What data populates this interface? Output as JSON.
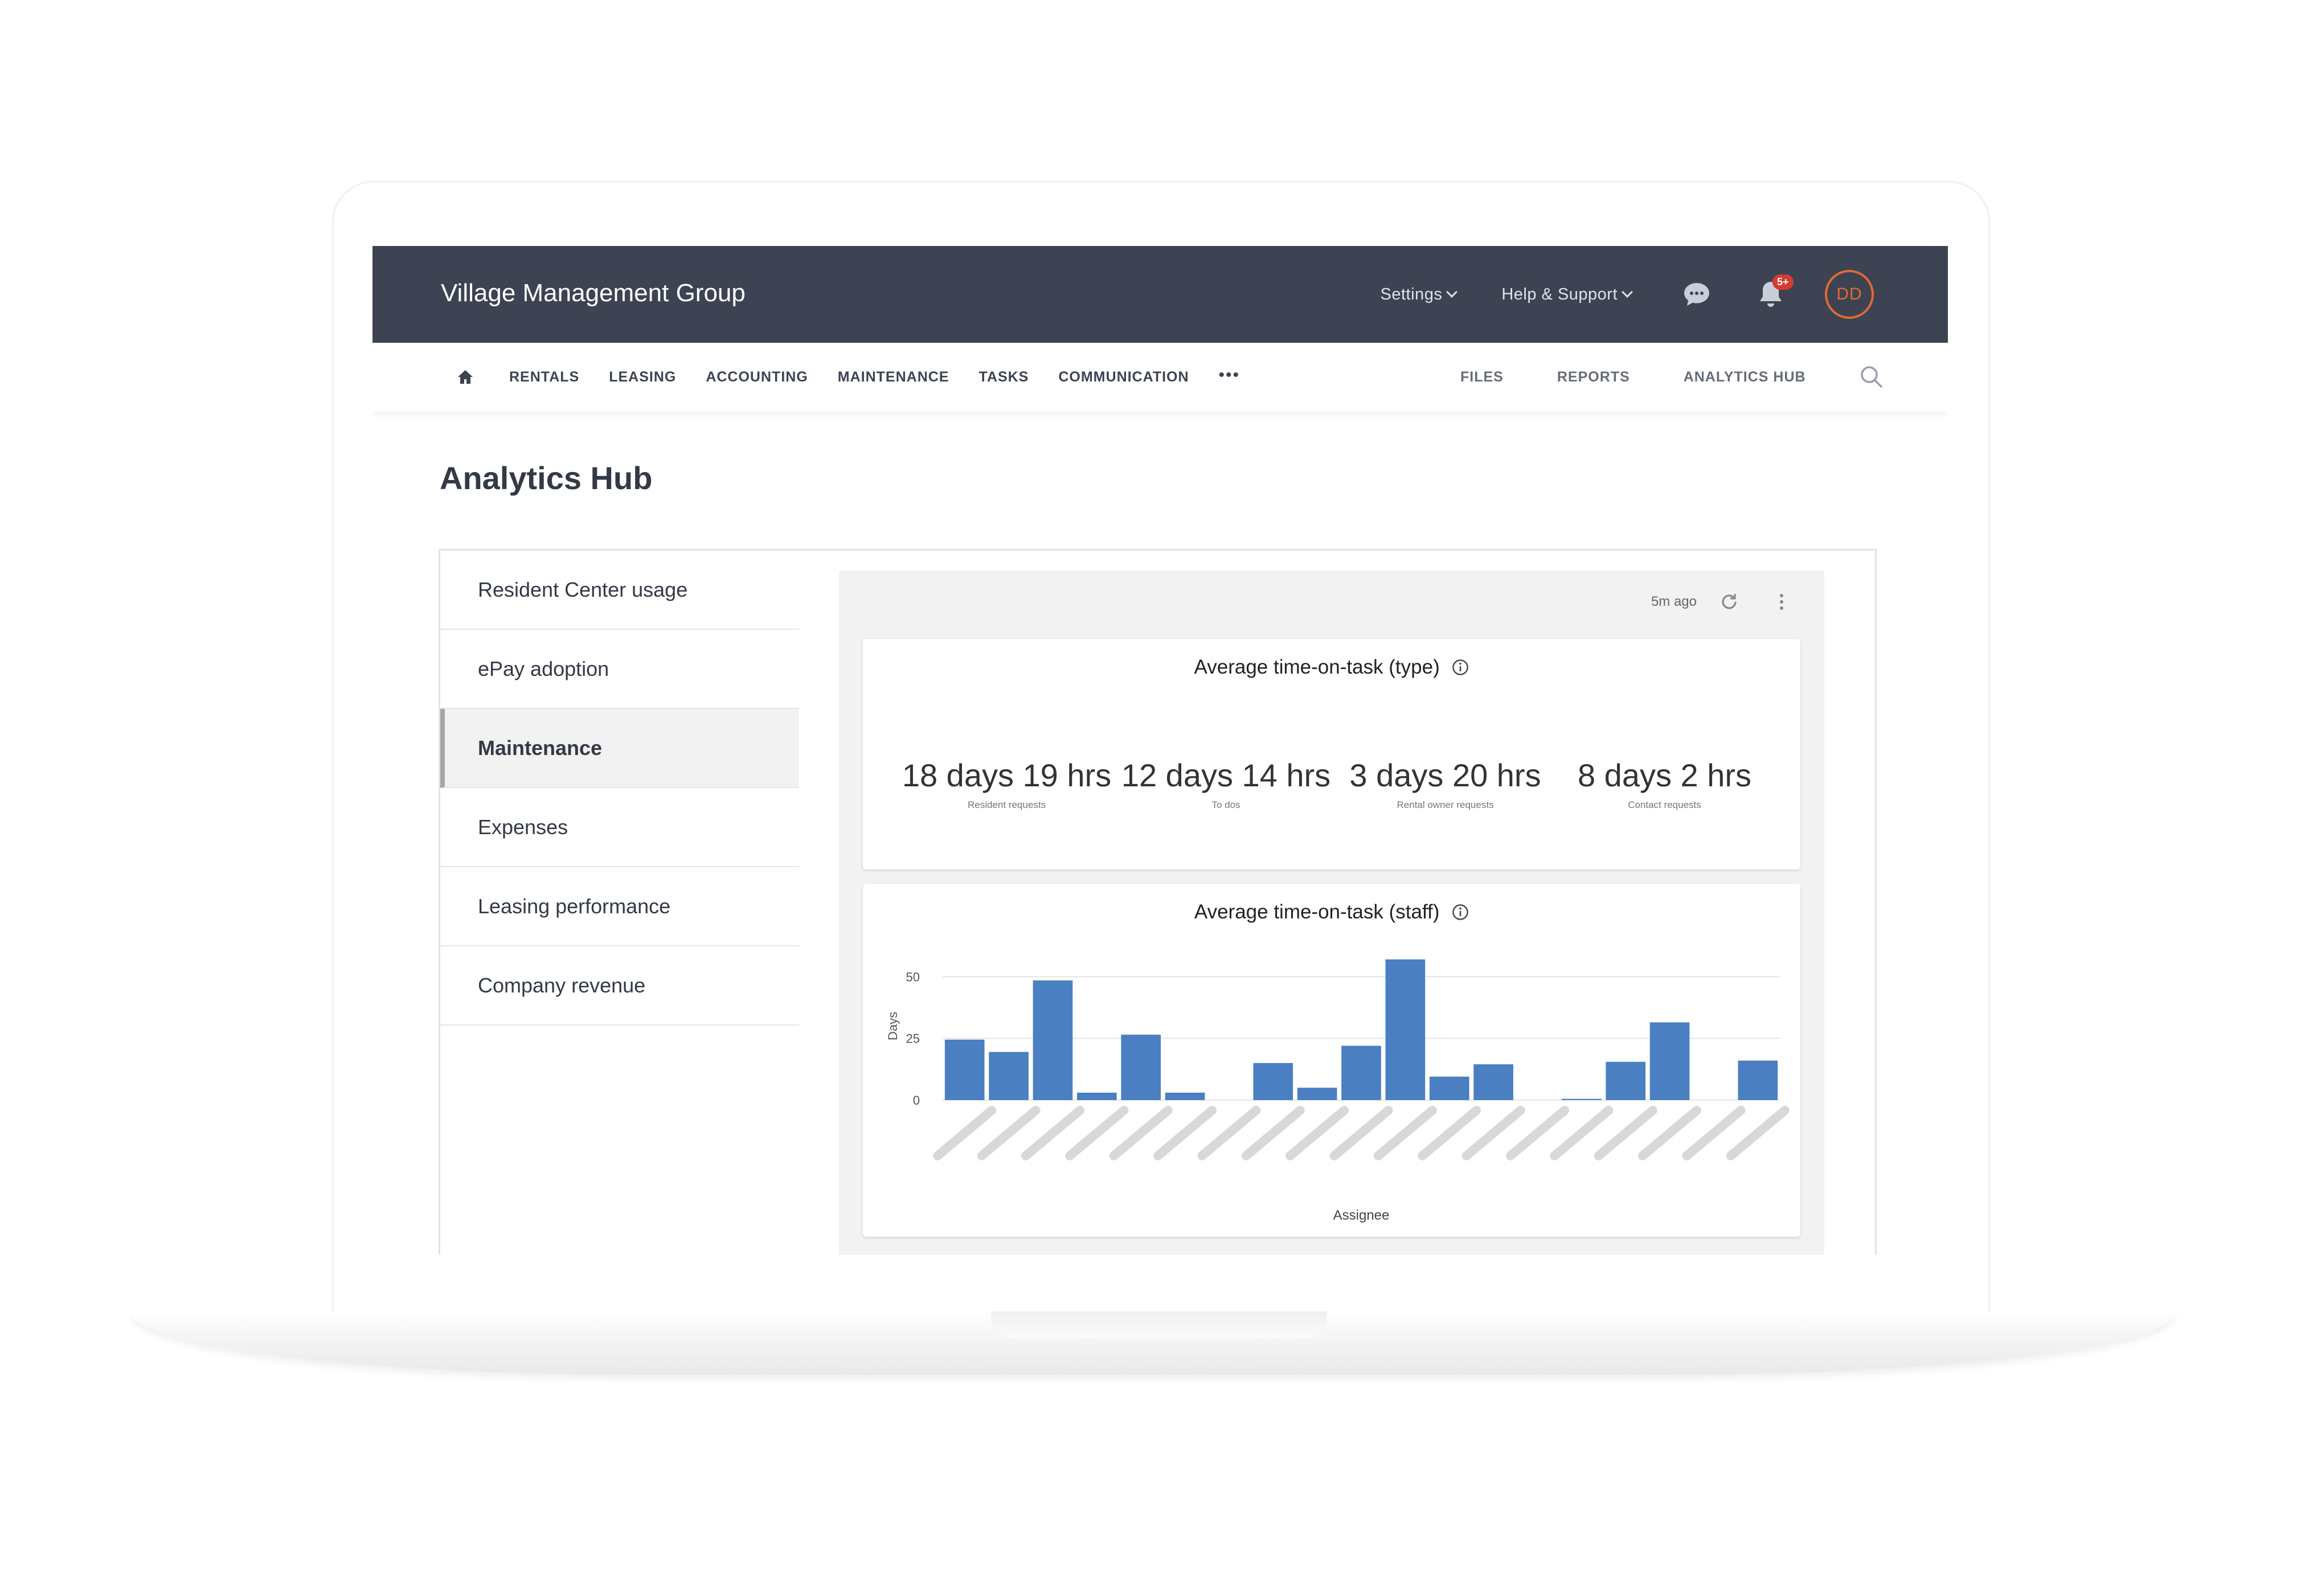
{
  "brand": "Village Management Group",
  "topnav": {
    "settings": "Settings",
    "help": "Help & Support",
    "notifications_badge": "5+",
    "avatar_initials": "DD"
  },
  "subnav": {
    "left": [
      "RENTALS",
      "LEASING",
      "ACCOUNTING",
      "MAINTENANCE",
      "TASKS",
      "COMMUNICATION"
    ],
    "right": [
      "FILES",
      "REPORTS",
      "ANALYTICS HUB"
    ]
  },
  "page_title": "Analytics Hub",
  "side_menu": [
    {
      "label": "Resident Center usage",
      "active": false
    },
    {
      "label": "ePay adoption",
      "active": false
    },
    {
      "label": "Maintenance",
      "active": true
    },
    {
      "label": "Expenses",
      "active": false
    },
    {
      "label": "Leasing performance",
      "active": false
    },
    {
      "label": "Company revenue",
      "active": false
    }
  ],
  "toolbar": {
    "updated": "5m ago"
  },
  "type_card": {
    "title": "Average time-on-task (type)",
    "metrics": [
      {
        "value": "18 days 19 hrs",
        "label": "Resident requests"
      },
      {
        "value": "12 days 14 hrs",
        "label": "To dos"
      },
      {
        "value": "3 days 20 hrs",
        "label": "Rental owner requests"
      },
      {
        "value": "8 days 2 hrs",
        "label": "Contact requests"
      }
    ]
  },
  "staff_card": {
    "title": "Average time-on-task (staff)"
  },
  "chart_data": {
    "type": "bar",
    "ylabel": "Days",
    "xlabel": "Assignee",
    "ylim": [
      0,
      60
    ],
    "yticks": [
      0,
      25,
      50
    ],
    "grid": true,
    "color": "#4a7fc1",
    "values": [
      24.5,
      19.5,
      48.5,
      3,
      26.5,
      3,
      0,
      15,
      5,
      22,
      57,
      9.5,
      14.5,
      0,
      0.5,
      15.5,
      31.5,
      0,
      16
    ]
  },
  "colors": {
    "topbar": "#3d4352",
    "accent": "#e06a35",
    "badge": "#d43c2f",
    "bar": "#4a7fc1"
  }
}
